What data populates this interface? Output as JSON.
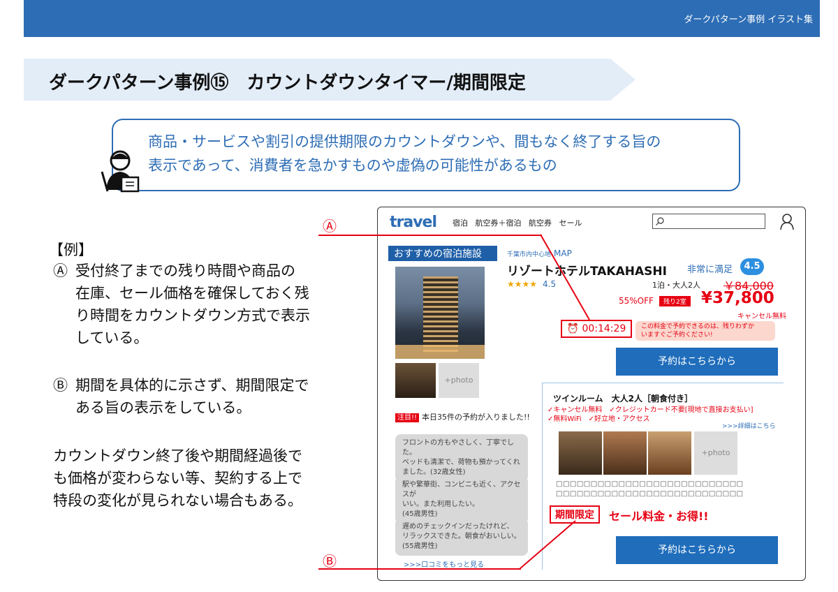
{
  "header": {
    "series_title": "ダークパターン事例 イラスト集"
  },
  "title": "ダークパターン事例⑮　カウントダウンタイマー/期間限定",
  "definition": [
    "商品・サービスや割引の提供期限のカウントダウンや、間もなく終了する旨の",
    "表示であって、消費者を急かすものや虚偽の可能性があるもの"
  ],
  "examples": {
    "heading": "【例】",
    "items": [
      {
        "mark": "Ⓐ",
        "lines": [
          "受付終了までの残り時間や商品の",
          "在庫、セール価格を確保しておく残",
          "り時間をカウントダウン方式で表示",
          "している。"
        ]
      },
      {
        "mark": "Ⓑ",
        "lines": [
          "期間を具体的に示さず、期間限定で",
          "ある旨の表示をしている。"
        ]
      }
    ],
    "note": [
      "カウントダウン終了後や期間経過後で",
      "も価格が変わらない等、契約する上で",
      "特段の変化が見られない場合もある。"
    ]
  },
  "callouts": {
    "a": "Ⓐ",
    "b": "Ⓑ"
  },
  "mock": {
    "logo": "travel",
    "nav": [
      "宿泊",
      "航空券＋宿泊",
      "航空券",
      "セール"
    ],
    "search_placeholder": "",
    "recommended_tag": "おすすめの宿泊施設",
    "photo_placeholder": "+photo",
    "notice_badge": "注目!!",
    "notice_text": "本日35件の予約が入りました!!",
    "reviews": [
      [
        "フロントの方もやさしく、丁寧でした。",
        "ベッドも清潔で、荷物も預かってくれ",
        "ました。(32歳女性)"
      ],
      [
        "駅や繁華街、コンビニも近く、アクセスが",
        "いい。また利用したい。",
        "(45歳男性)"
      ],
      [
        "遅めのチェックインだったけれど、",
        "リラックスできた。朝食がおいしい。",
        "(55歳男性)"
      ]
    ],
    "more_reviews": ">>>口コミをもっと見る",
    "location": "千葉市内中心地",
    "map": "MAP",
    "hotel_name": "リゾートホテルTAKAHASHI",
    "stars": "★★★★",
    "rating": "4.5",
    "satisfaction": "非常に満足",
    "satisfaction_score": "4.5",
    "guests": "1泊・大人2人",
    "old_price": "￥84,000",
    "discount": "55%OFF",
    "rooms_left": "残り2室",
    "new_price": "¥37,800",
    "cancel_free": "キャンセル無料",
    "timer": "⏰ 00:14:29",
    "timer_msg": [
      "この料金で予約できるのは、残りわずか",
      "いますぐご予約ください!"
    ],
    "book_button": "予約はこちらから",
    "room": {
      "title": "ツインルーム　大人2人［朝食付き］",
      "features": [
        "✓キャンセル無料　✓クレジットカード不要[現地で直接お支払い]",
        "✓無料WiFi　✓好立地・アクセス"
      ],
      "detail_link": ">>>詳細はこちら",
      "boxes": [
        "□□□□□□□□□□□□□□□□□□□□□□□□□□□",
        "□□□□□□□□□□□□□□□□□□□□□□□□□□□"
      ],
      "limited": "期間限定",
      "sale": "セール料金・お得!!"
    }
  }
}
